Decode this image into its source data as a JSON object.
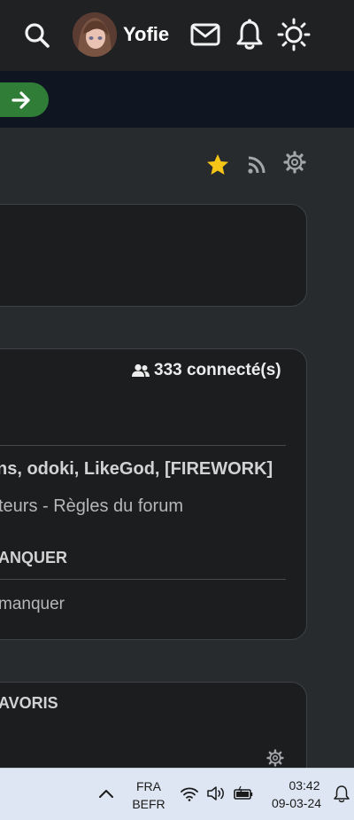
{
  "header": {
    "username": "Yofie",
    "icons": [
      "search-icon",
      "avatar",
      "mail-icon",
      "bell-icon",
      "sun-icon"
    ]
  },
  "banner": {
    "button_icon": "arrow-right-icon",
    "button_color": "#2f7d37"
  },
  "toolbar": {
    "icons": [
      "star-icon",
      "rss-icon",
      "gear-icon"
    ],
    "star_color": "#f5c518"
  },
  "online_panel": {
    "count_label": "333 connecté(s)",
    "users_line": "ns, odoki, LikeGod, [FIREWORK]",
    "links_line": "teurs - Règles du forum",
    "section_title": "ANQUER",
    "section_text": "manquer"
  },
  "favorites_panel": {
    "title": "AVORIS"
  },
  "taskbar": {
    "lang_top": "FRA",
    "lang_bottom": "BEFR",
    "time": "03:42",
    "date": "09-03-24"
  }
}
